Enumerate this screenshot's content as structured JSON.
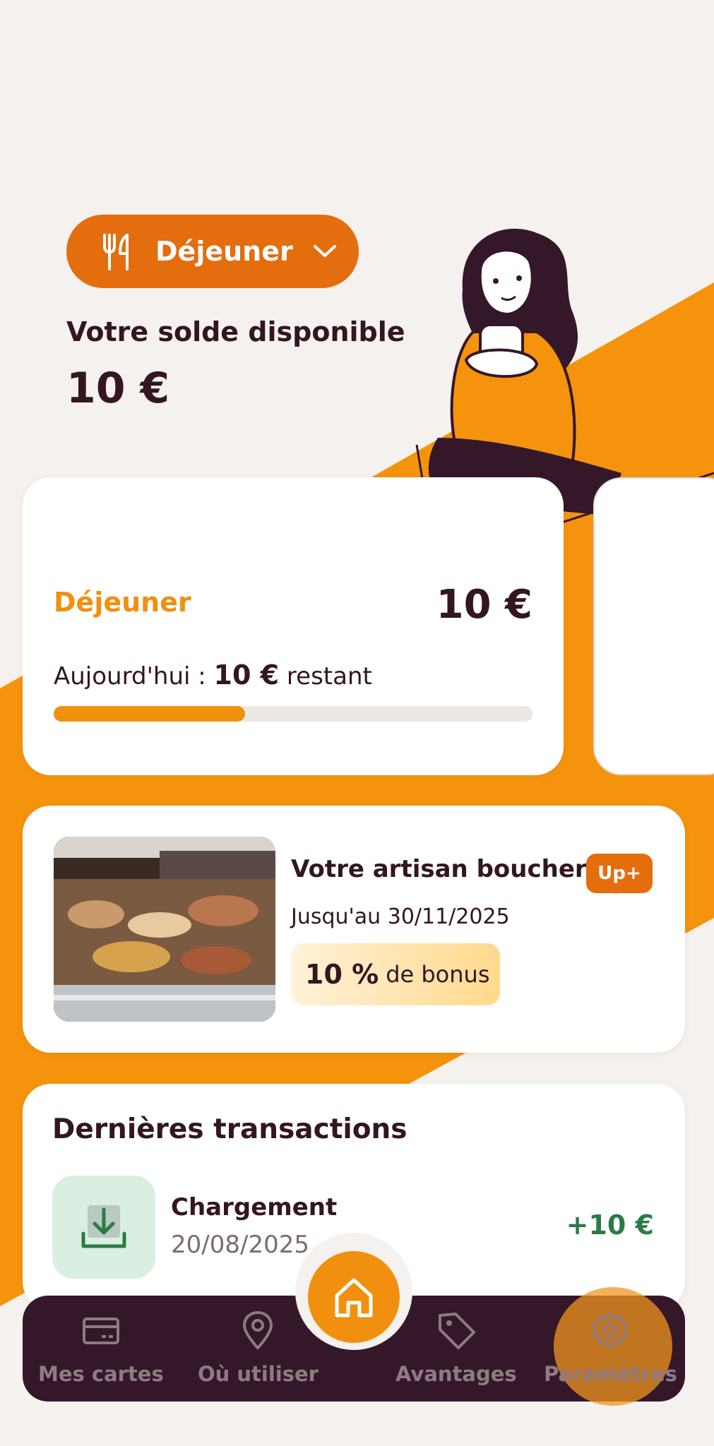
{
  "header": {
    "meal_selector": {
      "label": "Déjeuner",
      "icon": "fork-knife-icon"
    },
    "balance_title": "Votre solde disponible",
    "balance_value": "10 €"
  },
  "main_card": {
    "name": "Déjeuner",
    "amount": "10 €",
    "today_prefix": "Aujourd'hui :",
    "today_amount": "10 €",
    "today_suffix": "restant",
    "progress_fraction": 0.4
  },
  "offer": {
    "title": "Votre artisan boucher",
    "badge": "Up+",
    "date": "Jusqu'au 30/11/2025",
    "bonus_value": "10 %",
    "bonus_label": "de bonus"
  },
  "transactions": {
    "title": "Dernières transactions",
    "items": [
      {
        "name": "Chargement",
        "date": "20/08/2025",
        "amount": "+10 €",
        "icon": "download-icon"
      }
    ]
  },
  "nav": {
    "items": [
      {
        "label": "Mes cartes",
        "icon": "card-icon"
      },
      {
        "label": "Où utiliser",
        "icon": "location-pin-icon"
      },
      {
        "label": "Avantages",
        "icon": "tag-icon"
      },
      {
        "label": "Paramètres",
        "icon": "gear-icon"
      }
    ],
    "home_icon": "home-icon"
  },
  "colors": {
    "accent": "#f0900e",
    "accent_dark": "#e46d0e",
    "text_dark": "#33161f",
    "nav_bg": "#35172a",
    "positive": "#2e7a45"
  }
}
